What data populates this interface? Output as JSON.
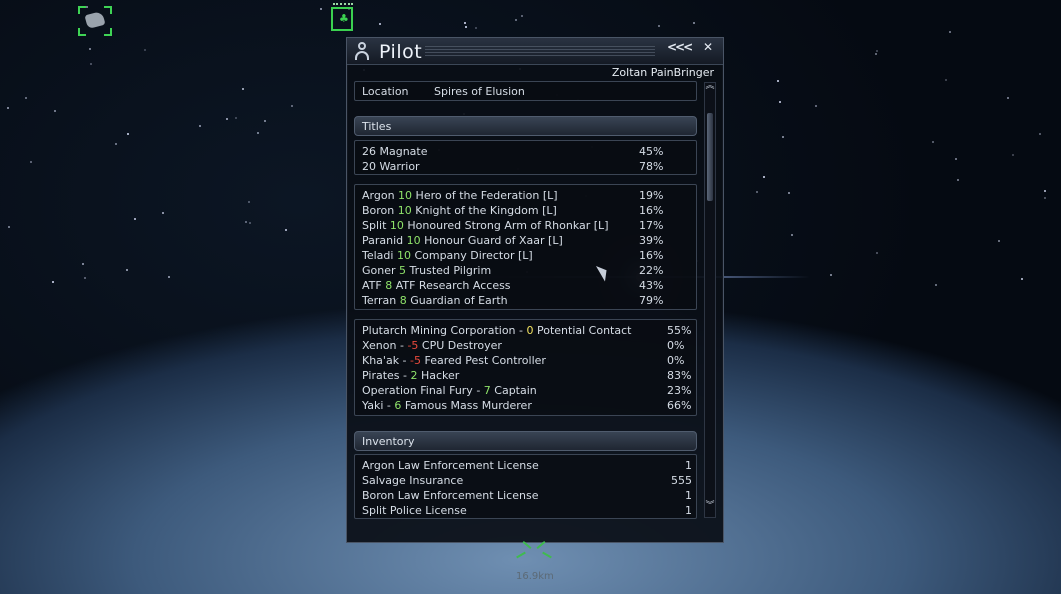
{
  "window": {
    "title": "Pilot",
    "collapse_icon": "<<<",
    "close_icon": "✕",
    "pilot_name": "Zoltan PainBringer"
  },
  "location": {
    "label": "Location",
    "value": "Spires of Elusion"
  },
  "titles_header": "Titles",
  "ranks": [
    {
      "name": "26 Magnate",
      "pct": "45%"
    },
    {
      "name": "20 Warrior",
      "pct": "78%"
    }
  ],
  "race_titles": [
    {
      "race": "Argon",
      "level": "10",
      "title": "Hero of the Federation [L]",
      "pct": "19%"
    },
    {
      "race": "Boron",
      "level": "10",
      "title": "Knight of the Kingdom [L]",
      "pct": "16%"
    },
    {
      "race": "Split",
      "level": "10",
      "title": "Honoured Strong Arm of Rhonkar  [L]",
      "pct": "17%"
    },
    {
      "race": "Paranid",
      "level": "10",
      "title": "Honour Guard of Xaar [L]",
      "pct": "39%"
    },
    {
      "race": "Teladi",
      "level": "10",
      "title": "Company Director  [L]",
      "pct": "16%"
    },
    {
      "race": "Goner",
      "level": "5",
      "title": "Trusted Pilgrim",
      "pct": "22%"
    },
    {
      "race": "ATF",
      "level": "8",
      "title": "ATF Research Access",
      "pct": "43%"
    },
    {
      "race": "Terran",
      "level": "8",
      "title": "Guardian of Earth",
      "pct": "79%"
    }
  ],
  "faction_titles": [
    {
      "faction": "Plutarch Mining Corporation - ",
      "level": "0",
      "level_color": "y",
      "title": "Potential Contact",
      "pct": "55%"
    },
    {
      "faction": "Xenon - ",
      "level": "-5",
      "level_color": "r",
      "title": "CPU Destroyer",
      "pct": "0%"
    },
    {
      "faction": "Kha'ak - ",
      "level": "-5",
      "level_color": "r",
      "title": "Feared Pest Controller",
      "pct": "0%"
    },
    {
      "faction": "Pirates - ",
      "level": "2",
      "level_color": "g",
      "title": "Hacker",
      "pct": "83%"
    },
    {
      "faction": "Operation Final Fury - ",
      "level": "7",
      "level_color": "g",
      "title": "Captain",
      "pct": "23%"
    },
    {
      "faction": "Yaki - ",
      "level": "6",
      "level_color": "g",
      "title": "Famous Mass Murderer",
      "pct": "66%"
    }
  ],
  "inventory_header": "Inventory",
  "inventory": [
    {
      "name": "Argon Law Enforcement License",
      "qty": "1"
    },
    {
      "name": "Salvage Insurance",
      "qty": "555"
    },
    {
      "name": "Boron Law Enforcement License",
      "qty": "1"
    },
    {
      "name": "Split Police License",
      "qty": "1"
    }
  ],
  "scroll": {
    "up_icon": "︽",
    "down_icon": "︾"
  },
  "hud": {
    "distance": "16.9km"
  },
  "colors": {
    "positive": "#8fe36a",
    "negative": "#e84a3c",
    "neutral": "#f0e060",
    "hud_green": "#3bd150"
  }
}
